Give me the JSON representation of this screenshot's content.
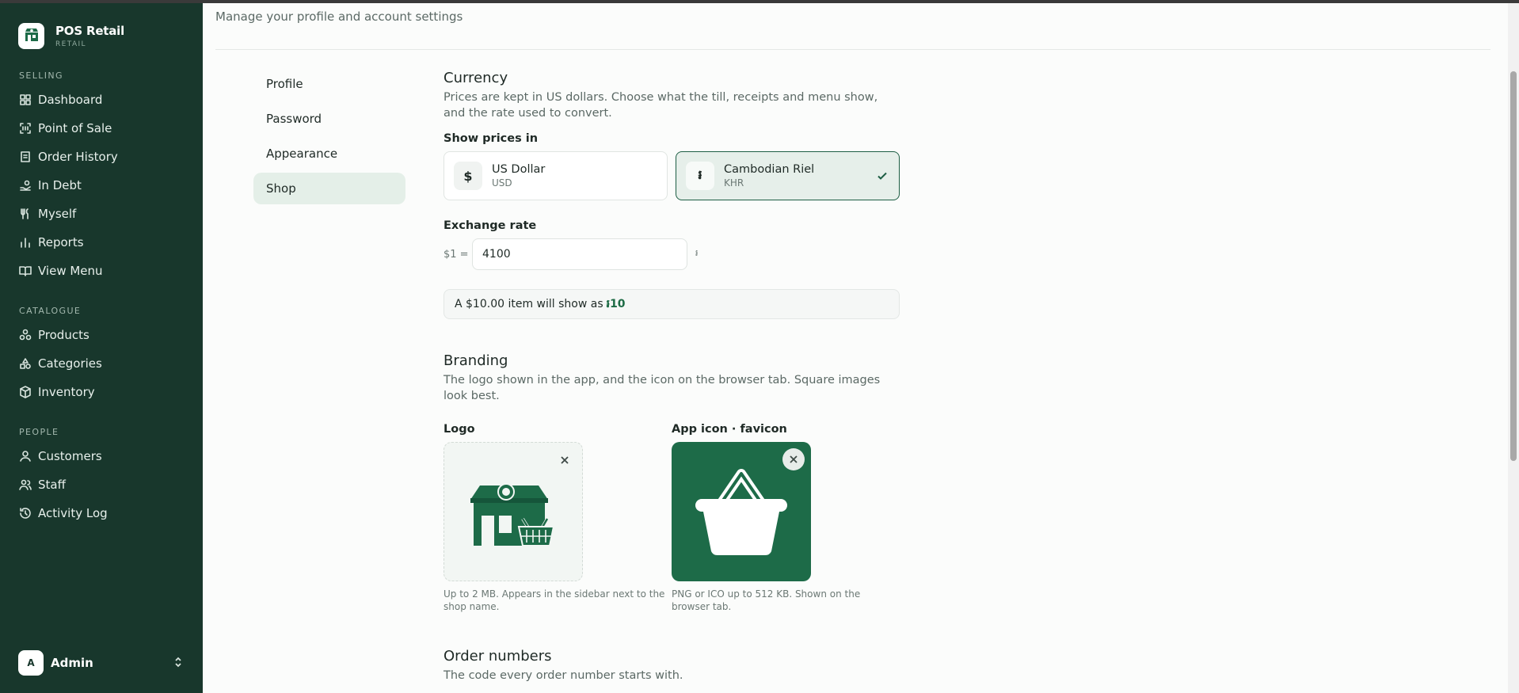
{
  "app": {
    "name": "POS Retail",
    "subtitle": "RETAIL"
  },
  "sidebar": {
    "sections": [
      {
        "label": "SELLING",
        "items": [
          {
            "label": "Dashboard",
            "icon": "dashboard-icon"
          },
          {
            "label": "Point of Sale",
            "icon": "scan-icon"
          },
          {
            "label": "Order History",
            "icon": "receipt-icon"
          },
          {
            "label": "In Debt",
            "icon": "hand-coins-icon"
          },
          {
            "label": "Myself",
            "icon": "utensils-icon"
          },
          {
            "label": "Reports",
            "icon": "bar-chart-icon"
          },
          {
            "label": "View Menu",
            "icon": "book-open-icon"
          }
        ]
      },
      {
        "label": "CATALOGUE",
        "items": [
          {
            "label": "Products",
            "icon": "boxes-icon"
          },
          {
            "label": "Categories",
            "icon": "shapes-icon"
          },
          {
            "label": "Inventory",
            "icon": "package-icon"
          }
        ]
      },
      {
        "label": "PEOPLE",
        "items": [
          {
            "label": "Customers",
            "icon": "user-icon"
          },
          {
            "label": "Staff",
            "icon": "users-icon"
          },
          {
            "label": "Activity Log",
            "icon": "history-icon"
          }
        ]
      }
    ],
    "user": {
      "initial": "A",
      "name": "Admin"
    }
  },
  "page": {
    "subtitle": "Manage your profile and account settings"
  },
  "settings_nav": [
    {
      "label": "Profile",
      "active": false
    },
    {
      "label": "Password",
      "active": false
    },
    {
      "label": "Appearance",
      "active": false
    },
    {
      "label": "Shop",
      "active": true
    }
  ],
  "currency": {
    "title": "Currency",
    "description": "Prices are kept in US dollars. Choose what the till, receipts and menu show, and the rate used to convert.",
    "show_prices_label": "Show prices in",
    "options": [
      {
        "symbol": "$",
        "name": "US Dollar",
        "code": "USD",
        "selected": false
      },
      {
        "symbol": "៛",
        "name": "Cambodian Riel",
        "code": "KHR",
        "selected": true
      }
    ],
    "exchange_label": "Exchange rate",
    "rate_prefix": "$1 =",
    "rate_value": "4100",
    "rate_suffix": "៛",
    "preview_text": "A $10.00 item will show as",
    "preview_amount": "៛10"
  },
  "branding": {
    "title": "Branding",
    "description": "The logo shown in the app, and the icon on the browser tab. Square images look best.",
    "logo_label": "Logo",
    "logo_hint": "Up to 2 MB. Appears in the sidebar next to the shop name.",
    "favicon_label": "App icon · favicon",
    "favicon_hint": "PNG or ICO up to 512 KB. Shown on the browser tab."
  },
  "order_numbers": {
    "title": "Order numbers",
    "description": "The code every order number starts with."
  },
  "colors": {
    "sidebar_bg": "#18372c",
    "accent": "#1d6b48",
    "selected_bg": "#e6efea"
  }
}
